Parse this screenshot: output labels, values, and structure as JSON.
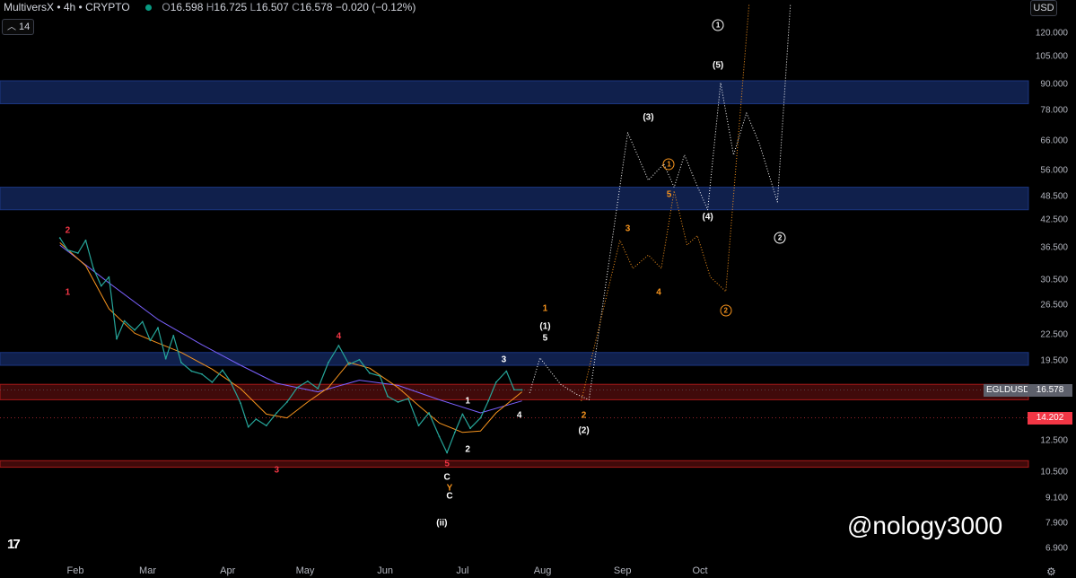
{
  "header": {
    "title": "MultiversX • 4h • CRYPTO",
    "o_label": "O",
    "o": "16.598",
    "h_label": "H",
    "h": "16.725",
    "l_label": "L",
    "l": "16.507",
    "c_label": "C",
    "c": "16.578",
    "change": "−0.020 (−0.12%)"
  },
  "indicators_collapsed": {
    "count": "14",
    "icon": "chevron-up-icon"
  },
  "currency": "USD",
  "symbol_tag": "EGLDUSD",
  "current_price": "16.578",
  "level_price": "14.202",
  "watermark": "@nology3000",
  "colors": {
    "background": "#000000",
    "price": "#26a69a",
    "ma_fast": "#f7941d",
    "ma_slow": "#7b61ff",
    "zone_blue": "#1e3a8a",
    "zone_red": "#b71c1c",
    "projection_white": "#ffffff",
    "projection_orange": "#f7941d",
    "label_red": "#f23645"
  },
  "chart_data": {
    "type": "line",
    "y_scale": "log",
    "ylim": [
      6.2,
      140
    ],
    "x_ticks": [
      "Feb",
      "Mar",
      "Apr",
      "May",
      "Jun",
      "Jul",
      "Aug",
      "Sep",
      "Oct"
    ],
    "y_ticks": [
      120,
      105,
      90,
      78,
      66,
      56,
      48.5,
      42.5,
      36.5,
      30.5,
      26.5,
      22.5,
      19.5,
      14.202,
      12.5,
      10.5,
      9.1,
      7.9,
      6.9
    ],
    "y_tick_labels": [
      "120.000",
      "105.000",
      "90.000",
      "78.000",
      "66.000",
      "56.000",
      "48.500",
      "42.500",
      "36.500",
      "30.500",
      "26.500",
      "22.500",
      "19.500",
      "",
      "12.500",
      "10.500",
      "9.100",
      "7.900",
      "6.900"
    ],
    "zones": [
      {
        "color": "blue",
        "low": 81,
        "high": 92
      },
      {
        "color": "blue",
        "low": 45,
        "high": 51
      },
      {
        "color": "blue",
        "low": 19.0,
        "high": 20.4
      },
      {
        "color": "red",
        "low": 15.7,
        "high": 17.1
      },
      {
        "color": "red",
        "low": 10.8,
        "high": 11.2
      }
    ],
    "price": [
      [
        "Jan 26",
        38.5
      ],
      [
        "Jan 29",
        36
      ],
      [
        "Feb 2",
        35.4
      ],
      [
        "Feb 5",
        38
      ],
      [
        "Feb 8",
        32.5
      ],
      [
        "Feb 11",
        29.5
      ],
      [
        "Feb 14",
        31
      ],
      [
        "Feb 17",
        22
      ],
      [
        "Feb 20",
        24.3
      ],
      [
        "Feb 24",
        23.1
      ],
      [
        "Feb 27",
        24.2
      ],
      [
        "Mar 2",
        21.8
      ],
      [
        "Mar 5",
        23.4
      ],
      [
        "Mar 8",
        19.7
      ],
      [
        "Mar 11",
        22.4
      ],
      [
        "Mar 14",
        19.3
      ],
      [
        "Mar 18",
        18.4
      ],
      [
        "Mar 22",
        18.1
      ],
      [
        "Mar 26",
        17.3
      ],
      [
        "Mar 30",
        18.5
      ],
      [
        "Apr 2",
        17.4
      ],
      [
        "Apr 6",
        15.4
      ],
      [
        "Apr 9",
        13.5
      ],
      [
        "Apr 12",
        14.1
      ],
      [
        "Apr 16",
        13.6
      ],
      [
        "Apr 20",
        14.6
      ],
      [
        "Apr 24",
        15.5
      ],
      [
        "Apr 28",
        16.8
      ],
      [
        "May 2",
        17.4
      ],
      [
        "May 6",
        16.7
      ],
      [
        "May 10",
        19.3
      ],
      [
        "May 14",
        21.2
      ],
      [
        "May 18",
        19.1
      ],
      [
        "May 22",
        19.6
      ],
      [
        "May 26",
        18.2
      ],
      [
        "May 30",
        17.9
      ],
      [
        "Jun 2",
        16
      ],
      [
        "Jun 6",
        15.5
      ],
      [
        "Jun 10",
        15.8
      ],
      [
        "Jun 14",
        13.6
      ],
      [
        "Jun 18",
        14.6
      ],
      [
        "Jun 22",
        12.8
      ],
      [
        "Jun 25",
        11.7
      ],
      [
        "Jun 28",
        13.1
      ],
      [
        "Jul 1",
        14.5
      ],
      [
        "Jul 4",
        13.4
      ],
      [
        "Jul 8",
        14.2
      ],
      [
        "Jul 11",
        15.6
      ],
      [
        "Jul 14",
        17.3
      ],
      [
        "Jul 18",
        18.4
      ],
      [
        "Jul 21",
        16.6
      ],
      [
        "Jul 24",
        16.578
      ]
    ],
    "ma_fast": [
      [
        "Jan 26",
        37.5
      ],
      [
        "Feb 5",
        33
      ],
      [
        "Feb 14",
        26
      ],
      [
        "Feb 24",
        22.7
      ],
      [
        "Mar 5",
        21.5
      ],
      [
        "Mar 14",
        20.4
      ],
      [
        "Mar 26",
        18.6
      ],
      [
        "Apr 6",
        16.7
      ],
      [
        "Apr 16",
        14.5
      ],
      [
        "Apr 24",
        14.2
      ],
      [
        "May 2",
        15.5
      ],
      [
        "May 10",
        16.8
      ],
      [
        "May 18",
        19.3
      ],
      [
        "May 26",
        18.7
      ],
      [
        "Jun 6",
        16.8
      ],
      [
        "Jun 14",
        15.2
      ],
      [
        "Jun 22",
        13.8
      ],
      [
        "Jul 1",
        13.1
      ],
      [
        "Jul 8",
        13.2
      ],
      [
        "Jul 14",
        14.6
      ],
      [
        "Jul 24",
        16.4
      ]
    ],
    "ma_slow": [
      [
        "Jan 26",
        37
      ],
      [
        "Feb 14",
        30
      ],
      [
        "Mar 5",
        24.5
      ],
      [
        "Mar 22",
        21.3
      ],
      [
        "Apr 6",
        19
      ],
      [
        "Apr 20",
        17.2
      ],
      [
        "May 6",
        16.4
      ],
      [
        "May 22",
        17.5
      ],
      [
        "Jun 6",
        17
      ],
      [
        "Jun 22",
        15.7
      ],
      [
        "Jul 8",
        14.6
      ],
      [
        "Jul 24",
        15.6
      ]
    ],
    "projection_white": [
      [
        "Jul 27",
        16.3
      ],
      [
        "Jul 31",
        19.8
      ],
      [
        "Aug 4",
        18.4
      ],
      [
        "Aug 8",
        17.1
      ],
      [
        "Aug 14",
        16.2
      ],
      [
        "Aug 19",
        15.7
      ],
      [
        "Sep 3",
        69
      ],
      [
        "Sep 11",
        53
      ],
      [
        "Sep 17",
        58
      ],
      [
        "Sep 21",
        51
      ],
      [
        "Sep 25",
        61
      ],
      [
        "Sep 29",
        53
      ],
      [
        "Oct 4",
        45
      ],
      [
        "Oct 9",
        91
      ],
      [
        "Oct 14",
        61
      ],
      [
        "Oct 19",
        77
      ],
      [
        "Oct 24",
        65
      ],
      [
        "Oct 31",
        47
      ],
      [
        "Nov 5",
        140
      ]
    ],
    "projection_orange": [
      [
        "Aug 16",
        15.6
      ],
      [
        "Aug 31",
        38
      ],
      [
        "Sep 5",
        32.5
      ],
      [
        "Sep 11",
        35
      ],
      [
        "Sep 16",
        32.5
      ],
      [
        "Sep 21",
        50
      ],
      [
        "Sep 26",
        37
      ],
      [
        "Sep 30",
        39
      ],
      [
        "Oct 5",
        31
      ],
      [
        "Oct 11",
        28.6
      ],
      [
        "Oct 20",
        140
      ]
    ],
    "labels": [
      {
        "text": "2",
        "x": "Jan 29",
        "y": 40,
        "color": "red"
      },
      {
        "text": "1",
        "x": "Jan 29",
        "y": 28.5,
        "color": "red"
      },
      {
        "text": "4",
        "x": "May 14",
        "y": 22.3,
        "color": "red"
      },
      {
        "text": "3",
        "x": "Apr 20",
        "y": 10.6,
        "color": "red"
      },
      {
        "text": "5",
        "x": "Jun 25",
        "y": 11.0,
        "color": "red"
      },
      {
        "text": "C",
        "x": "Jun 25",
        "y": 10.2,
        "color": "white"
      },
      {
        "text": "Y",
        "x": "Jun 26",
        "y": 9.6,
        "color": "orange"
      },
      {
        "text": "C",
        "x": "Jun 26",
        "y": 9.2,
        "color": "white"
      },
      {
        "text": "(ii)",
        "x": "Jun 23",
        "y": 7.9,
        "color": "white"
      },
      {
        "text": "1",
        "x": "Jul 3",
        "y": 15.6,
        "color": "white"
      },
      {
        "text": "2",
        "x": "Jul 3",
        "y": 11.9,
        "color": "white"
      },
      {
        "text": "3",
        "x": "Jul 17",
        "y": 19.6,
        "color": "white"
      },
      {
        "text": "4",
        "x": "Jul 23",
        "y": 14.4,
        "color": "white"
      },
      {
        "text": "1",
        "x": "Aug 2",
        "y": 26.0,
        "color": "orange"
      },
      {
        "text": "(1)",
        "x": "Aug 2",
        "y": 23.5,
        "color": "white"
      },
      {
        "text": "5",
        "x": "Aug 2",
        "y": 22.1,
        "color": "white"
      },
      {
        "text": "2",
        "x": "Aug 17",
        "y": 14.35,
        "color": "orange"
      },
      {
        "text": "(2)",
        "x": "Aug 17",
        "y": 13.2,
        "color": "white"
      },
      {
        "text": "3",
        "x": "Sep 3",
        "y": 40.5,
        "color": "orange"
      },
      {
        "text": "4",
        "x": "Sep 15",
        "y": 28.5,
        "color": "orange"
      },
      {
        "text": "(3)",
        "x": "Sep 11",
        "y": 75,
        "color": "white"
      },
      {
        "text": "1",
        "x": "Sep 19",
        "y": 58,
        "color": "orange",
        "circled": true
      },
      {
        "text": "5",
        "x": "Sep 19",
        "y": 49,
        "color": "orange"
      },
      {
        "text": "(4)",
        "x": "Oct 4",
        "y": 43.2,
        "color": "white"
      },
      {
        "text": "(5)",
        "x": "Oct 8",
        "y": 100,
        "color": "white"
      },
      {
        "text": "1",
        "x": "Oct 8",
        "y": 125,
        "color": "white",
        "circled": true
      },
      {
        "text": "2",
        "x": "Oct 11",
        "y": 25.7,
        "color": "orange",
        "circled": true
      },
      {
        "text": "2",
        "x": "Nov 1",
        "y": 38.5,
        "color": "white",
        "circled": true
      }
    ]
  }
}
